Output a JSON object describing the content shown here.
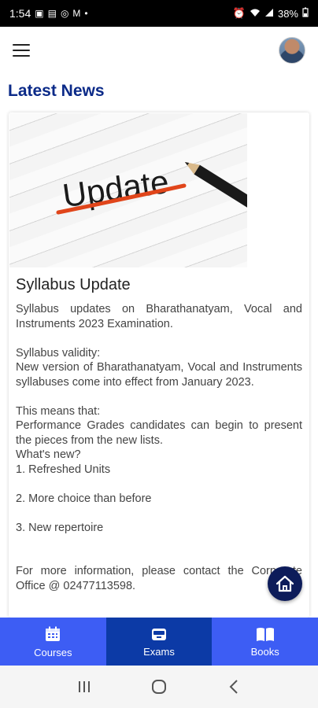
{
  "status_bar": {
    "time": "1:54",
    "battery": "38%"
  },
  "section": {
    "title": "Latest News"
  },
  "news": {
    "image_caption": "Update",
    "title": "Syllabus Update",
    "paragraphs": [
      "Syllabus updates on Bharathanatyam, Vocal and Instruments 2023 Examination.",
      "",
      "Syllabus validity:",
      "New version of Bharathanatyam, Vocal and Instruments syllabuses come into effect from January 2023.",
      "",
      "This means that:",
      "Performance Grades candidates can begin to present the pieces from the new lists.",
      "What's new?",
      "1. Refreshed Units",
      "",
      "2. More choice than before",
      "",
      "3. New repertoire",
      "",
      "",
      "For more information, please contact the Corporate Office @ 02477113598."
    ]
  },
  "bottom_nav": {
    "items": [
      {
        "label": "Courses",
        "icon": "calendar-icon"
      },
      {
        "label": "Exams",
        "icon": "inbox-icon"
      },
      {
        "label": "Books",
        "icon": "book-icon"
      }
    ],
    "active": "Exams"
  },
  "colors": {
    "title_blue": "#0b2a88",
    "nav_blue": "#3d5df4",
    "nav_active": "#0c3aa6",
    "fab": "#0d1c5a"
  }
}
